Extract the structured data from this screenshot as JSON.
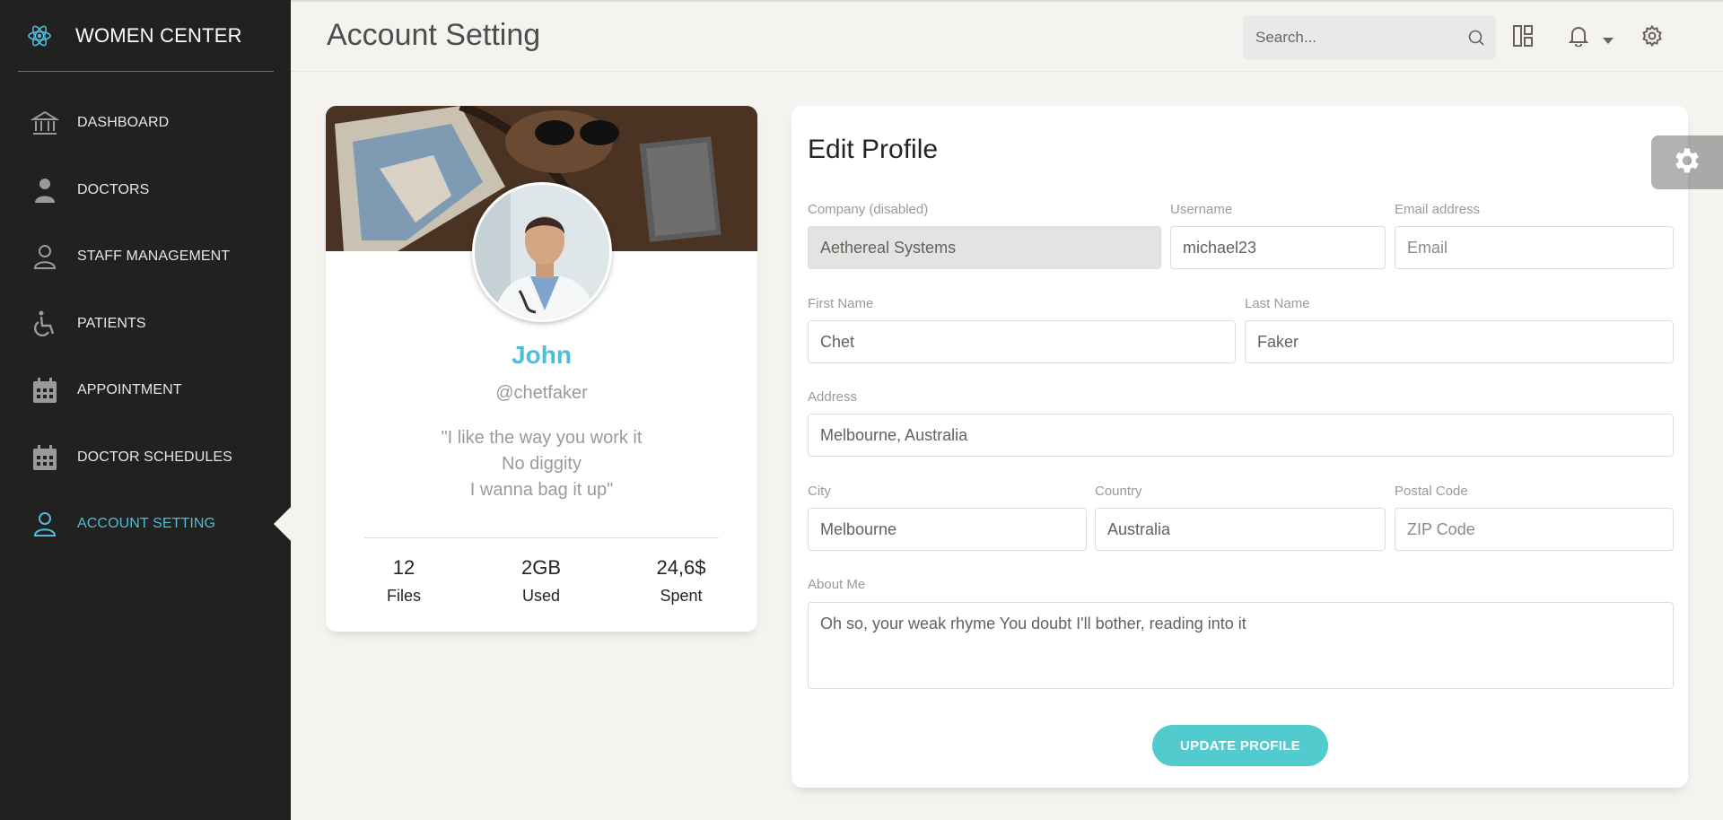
{
  "brand": {
    "title": "WOMEN CENTER",
    "logo_icon": "react-atom-icon",
    "accent": "#51bcda"
  },
  "sidebar": {
    "items": [
      {
        "label": "DASHBOARD",
        "icon": "bank-icon",
        "active": false
      },
      {
        "label": "DOCTORS",
        "icon": "doctor-icon",
        "active": false
      },
      {
        "label": "STAFF MANAGEMENT",
        "icon": "user-icon",
        "active": false
      },
      {
        "label": "PATIENTS",
        "icon": "wheelchair-icon",
        "active": false
      },
      {
        "label": "APPOINTMENT",
        "icon": "calendar-icon",
        "active": false
      },
      {
        "label": "DOCTOR SCHEDULES",
        "icon": "calendar-icon",
        "active": false
      },
      {
        "label": "ACCOUNT SETTING",
        "icon": "user-icon",
        "active": true
      }
    ]
  },
  "header": {
    "title": "Account Setting",
    "search_placeholder": "Search..."
  },
  "profile": {
    "name": "John",
    "handle": "@chetfaker",
    "quote_line1": "\"I like the way you work it",
    "quote_line2": "No diggity",
    "quote_line3": "I wanna bag it up\"",
    "stats": [
      {
        "value": "12",
        "label": "Files"
      },
      {
        "value": "2GB",
        "label": "Used"
      },
      {
        "value": "24,6$",
        "label": "Spent"
      }
    ]
  },
  "edit": {
    "title": "Edit Profile",
    "company_label": "Company (disabled)",
    "company_value": "Aethereal Systems",
    "username_label": "Username",
    "username_value": "michael23",
    "email_label": "Email address",
    "email_placeholder": "Email",
    "firstname_label": "First Name",
    "firstname_value": "Chet",
    "lastname_label": "Last Name",
    "lastname_value": "Faker",
    "address_label": "Address",
    "address_value": "Melbourne, Australia",
    "city_label": "City",
    "city_value": "Melbourne",
    "country_label": "Country",
    "country_value": "Australia",
    "postal_label": "Postal Code",
    "postal_placeholder": "ZIP Code",
    "about_label": "About Me",
    "about_value": "Oh so, your weak rhyme You doubt I'll bother, reading into it",
    "update_label": "UPDATE PROFILE"
  },
  "colors": {
    "sidebar_bg": "#212120",
    "primary": "#51cbce",
    "info": "#51bcda"
  }
}
